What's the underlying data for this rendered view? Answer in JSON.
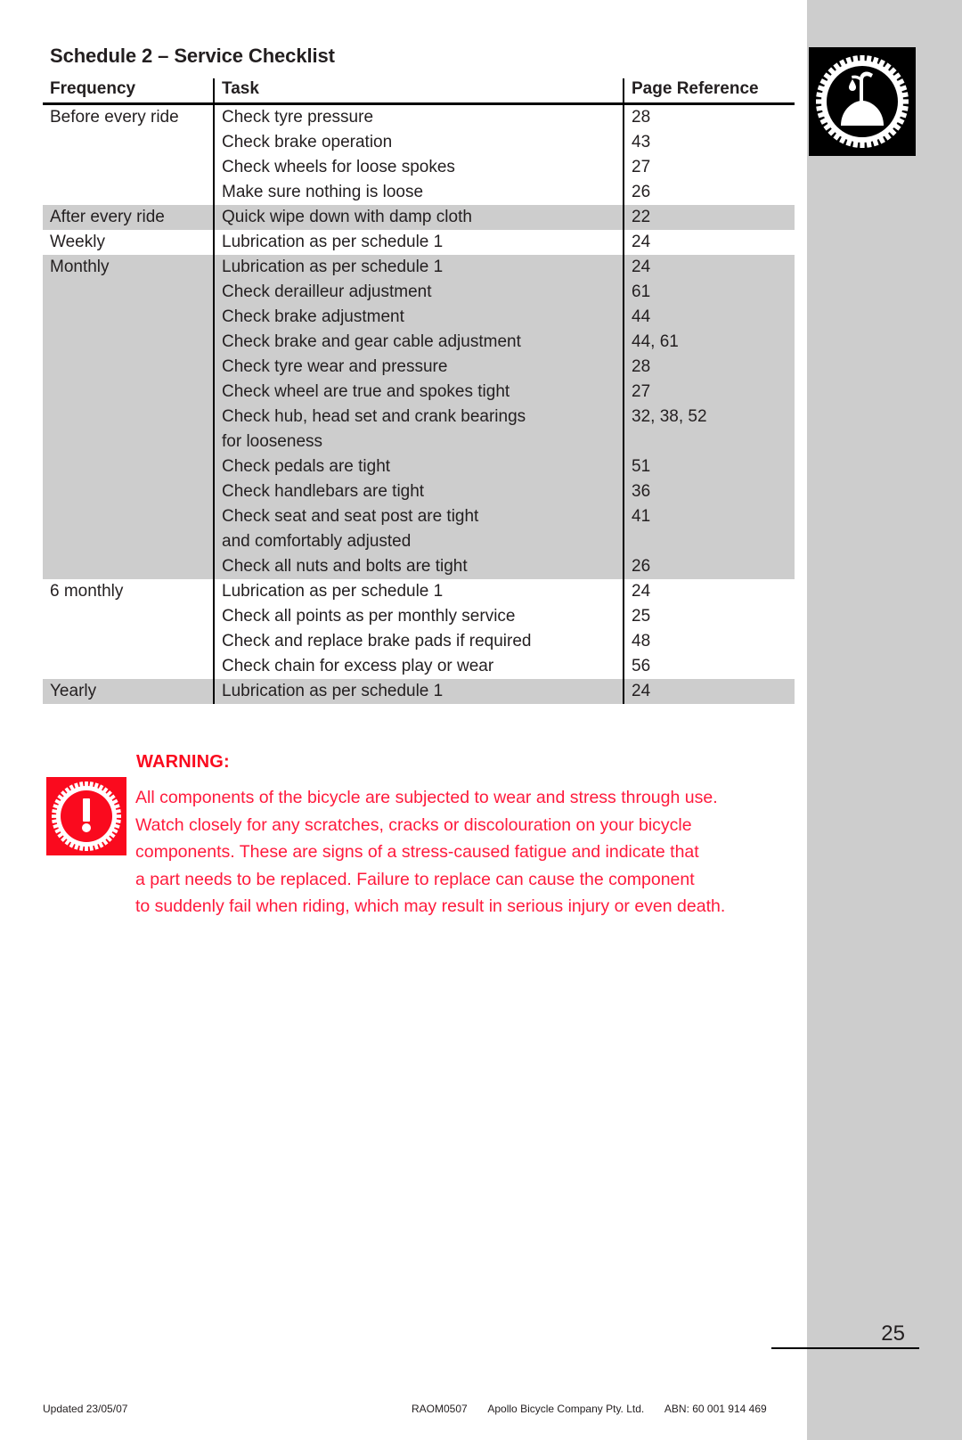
{
  "document": {
    "title": "Schedule 2 – Service Checklist",
    "page_number": "25",
    "logo_icon": "oil-can-in-cog-logo"
  },
  "table": {
    "columns": [
      "Frequency",
      "Task",
      "Page Reference"
    ],
    "rows": [
      {
        "frequency": "Before every ride",
        "task": "Check tyre pressure",
        "page": "28",
        "shaded": false
      },
      {
        "frequency": "",
        "task": "Check brake operation",
        "page": "43",
        "shaded": false
      },
      {
        "frequency": "",
        "task": "Check wheels for loose spokes",
        "page": "27",
        "shaded": false
      },
      {
        "frequency": "",
        "task": "Make sure nothing is loose",
        "page": "26",
        "shaded": false
      },
      {
        "frequency": "After every ride",
        "task": "Quick wipe down with damp cloth",
        "page": "22",
        "shaded": true
      },
      {
        "frequency": "Weekly",
        "task": "Lubrication as per schedule 1",
        "page": "24",
        "shaded": false
      },
      {
        "frequency": "Monthly",
        "task": "Lubrication as per schedule 1",
        "page": "24",
        "shaded": true
      },
      {
        "frequency": "",
        "task": "Check derailleur adjustment",
        "page": "61",
        "shaded": true
      },
      {
        "frequency": "",
        "task": "Check brake adjustment",
        "page": "44",
        "shaded": true
      },
      {
        "frequency": "",
        "task": "Check brake and gear cable adjustment",
        "page": "44, 61",
        "shaded": true
      },
      {
        "frequency": "",
        "task": "Check tyre wear and pressure",
        "page": "28",
        "shaded": true
      },
      {
        "frequency": "",
        "task": "Check wheel are true and spokes tight",
        "page": "27",
        "shaded": true
      },
      {
        "frequency": "",
        "task": "Check hub, head set and crank bearings",
        "page": "32, 38, 52",
        "shaded": true
      },
      {
        "frequency": "",
        "task": "for looseness",
        "page": "",
        "shaded": true
      },
      {
        "frequency": "",
        "task": "Check pedals are tight",
        "page": "51",
        "shaded": true
      },
      {
        "frequency": "",
        "task": "Check handlebars are tight",
        "page": "36",
        "shaded": true
      },
      {
        "frequency": "",
        "task": "Check seat and seat post are tight",
        "page": "41",
        "shaded": true
      },
      {
        "frequency": "",
        "task": "and comfortably adjusted",
        "page": "",
        "shaded": true
      },
      {
        "frequency": "",
        "task": "Check all nuts and bolts are tight",
        "page": "26",
        "shaded": true
      },
      {
        "frequency": "6 monthly",
        "task": "Lubrication as per schedule 1",
        "page": "24",
        "shaded": false
      },
      {
        "frequency": "",
        "task": "Check all points as per monthly service",
        "page": "25",
        "shaded": false
      },
      {
        "frequency": "",
        "task": "Check and replace brake pads if required",
        "page": "48",
        "shaded": false
      },
      {
        "frequency": "",
        "task": "Check chain for excess play or wear",
        "page": "56",
        "shaded": false
      },
      {
        "frequency": "Yearly",
        "task": "Lubrication as per schedule 1",
        "page": "24",
        "shaded": true
      }
    ]
  },
  "warning": {
    "icon": "exclamation-in-cog-icon",
    "title": "WARNING:",
    "lines": [
      "All components of the bicycle are subjected to wear and stress through use.",
      "Watch closely for any scratches, cracks or discolouration on your bicycle",
      "components.  These are signs of a stress-caused fatigue and indicate that",
      "a part needs to be replaced.   Failure to replace can cause the component",
      "to suddenly fail when riding, which may result in serious injury or even death."
    ],
    "color": "#ff1a3c"
  },
  "footer": {
    "updated": "Updated 23/05/07",
    "doc_code": "RAOM0507",
    "company": "Apollo Bicycle Company Pty. Ltd.",
    "abn": "ABN: 60 001 914 469"
  }
}
